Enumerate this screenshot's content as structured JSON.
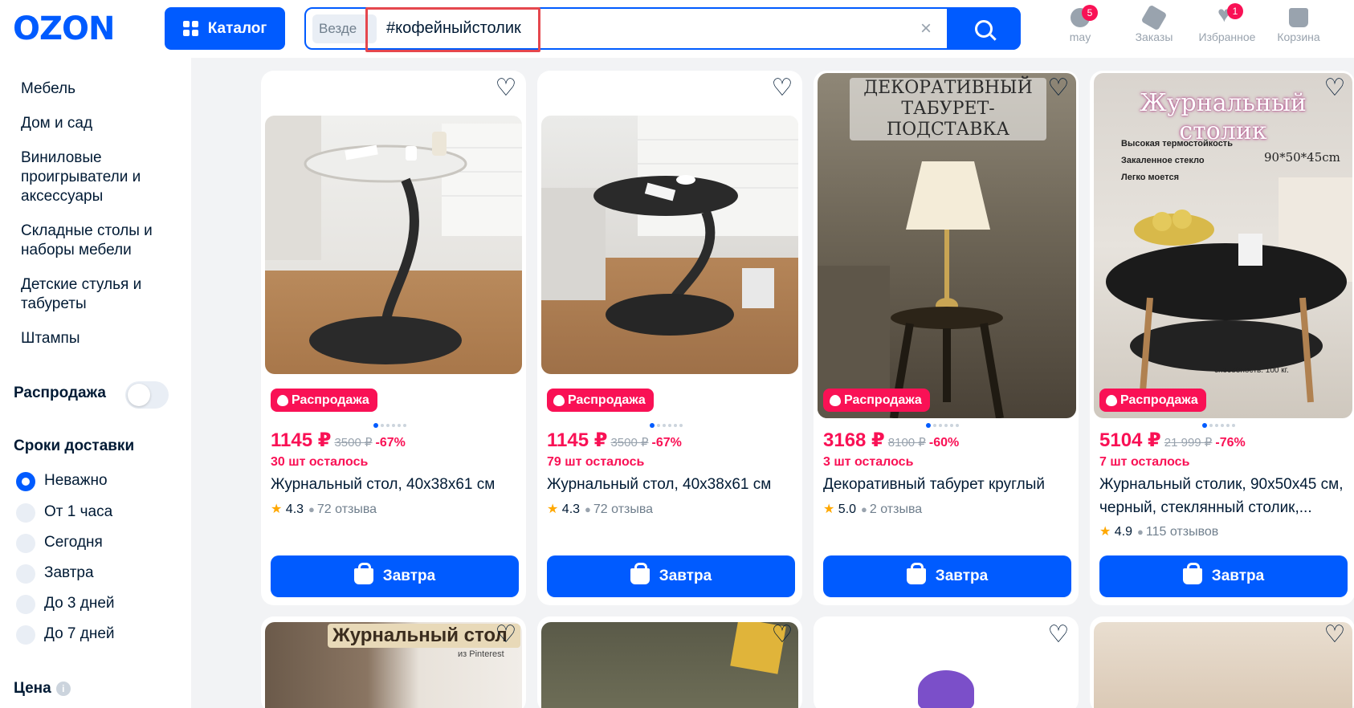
{
  "header": {
    "logo": "OZON",
    "catalog_label": "Каталог",
    "search_scope": "Везде",
    "search_value": "#кофейныйстолик",
    "clear_label": "×",
    "nav": [
      {
        "label": "may",
        "badge": "5",
        "icon": "user-icon"
      },
      {
        "label": "Заказы",
        "badge": "",
        "icon": "box-icon"
      },
      {
        "label": "Избранное",
        "badge": "1",
        "icon": "heart-icon"
      },
      {
        "label": "Корзина",
        "badge": "",
        "icon": "cart-icon"
      }
    ]
  },
  "sidebar": {
    "categories": [
      "Мебель",
      "Дом и сад",
      "Виниловые проигрыватели и аксессуары",
      "Складные столы и наборы мебели",
      "Детские стулья и табуреты",
      "Штампы"
    ],
    "sale_label": "Распродажа",
    "delivery_title": "Сроки доставки",
    "delivery_options": [
      "Неважно",
      "От 1 часа",
      "Сегодня",
      "Завтра",
      "До 3 дней",
      "До 7 дней"
    ],
    "price_title": "Цена",
    "info_glyph": "i"
  },
  "products": [
    {
      "sale": "Распродажа",
      "price": "1145 ₽",
      "old": "3500 ₽",
      "discount": "-67%",
      "stock": "30 шт осталось",
      "title": "Журнальный стол, 40х38х61 см",
      "rating": "4.3",
      "reviews": "72 отзыва",
      "cta": "Завтра"
    },
    {
      "sale": "Распродажа",
      "price": "1145 ₽",
      "old": "3500 ₽",
      "discount": "-67%",
      "stock": "79 шт осталось",
      "title": "Журнальный стол, 40х38х61 см",
      "rating": "4.3",
      "reviews": "72 отзыва",
      "cta": "Завтра"
    },
    {
      "sale": "Распродажа",
      "price": "3168 ₽",
      "old": "8100 ₽",
      "discount": "-60%",
      "stock": "3 шт осталось",
      "title": "Декоративный табурет круглый",
      "rating": "5.0",
      "reviews": "2 отзыва",
      "cta": "Завтра",
      "img_caption": "ДЕКОРАТИВНЫЙ ТАБУРЕТ-ПОДСТАВКА"
    },
    {
      "sale": "Распродажа",
      "price": "5104 ₽",
      "old": "21 999 ₽",
      "discount": "-76%",
      "stock": "7 шт осталось",
      "title": "Журнальный столик, 90х50х45 см, черный, стеклянный столик,...",
      "rating": "4.9",
      "reviews": "115 отзывов",
      "cta": "Завтра",
      "img_caption": "Журнальный столик",
      "img_notes": [
        "Высокая термостойкость",
        "Закаленное стекло",
        "Легко моется",
        "90*50*45cm",
        "способность: 100 кг."
      ]
    }
  ],
  "row2_captions": {
    "card1": "Журнальный стол",
    "card1_sub": "из Pinterest"
  },
  "colors": {
    "accent": "#005bff",
    "sale": "#f91155",
    "star": "#ffa800"
  }
}
